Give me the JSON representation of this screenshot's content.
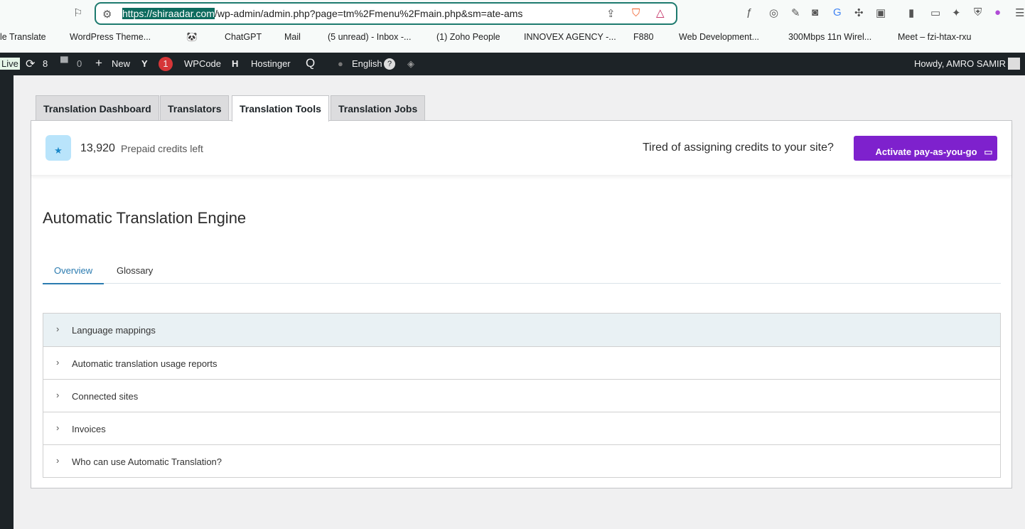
{
  "browser": {
    "url_host": "https://shiraadar.com",
    "url_path": "/wp-admin/admin.php?page=tm%2Fmenu%2Fmain.php&sm=ate-ams",
    "bookmarks": [
      "le Translate",
      "WordPress Theme...",
      "ChatGPT",
      "Mail",
      "(5 unread) - Inbox -...",
      "(1) Zoho People",
      "INNOVEX AGENCY -...",
      "F880",
      "Web Development...",
      "300Mbps 11n Wirel...",
      "Meet – fzi-htax-rxu"
    ]
  },
  "adminbar": {
    "live": "Live",
    "updates": "8",
    "comments": "0",
    "new": "New",
    "yoast_count": "1",
    "wpcode": "WPCode",
    "hostinger": "Hostinger",
    "language": "English",
    "howdy": "Howdy, AMRO SAMIR"
  },
  "tabs": [
    "Translation Dashboard",
    "Translators",
    "Translation Tools",
    "Translation Jobs"
  ],
  "credits": {
    "amount": "13,920",
    "label": "Prepaid credits left",
    "promo": "Tired of assigning credits to your site?",
    "button": "Activate pay-as-you-go"
  },
  "main": {
    "title": "Automatic Translation Engine",
    "subtabs": [
      "Overview",
      "Glossary"
    ],
    "sections": [
      "Language mappings",
      "Automatic translation usage reports",
      "Connected sites",
      "Invoices",
      "Who can use Automatic Translation?"
    ]
  },
  "colors": {
    "accent": "#7e21cd",
    "link": "#2b7bb0",
    "adminbar": "#1d2327"
  }
}
